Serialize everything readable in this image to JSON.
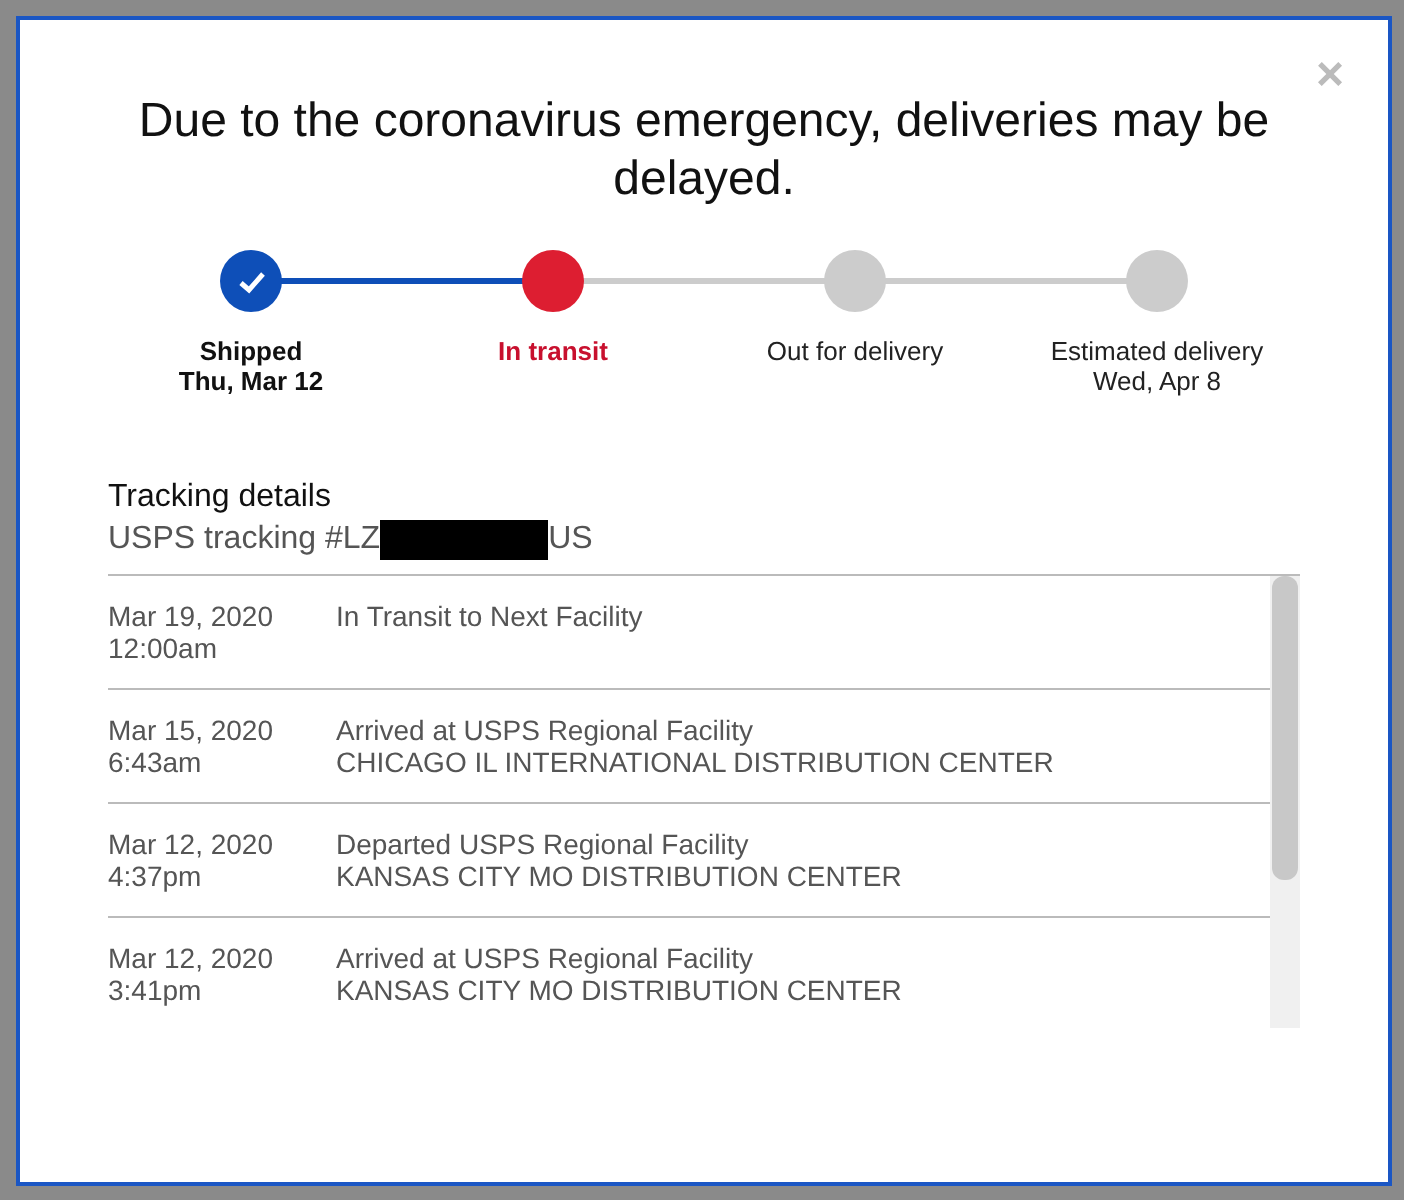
{
  "dialog": {
    "title": "Due to the coronavirus emergency, deliveries may be delayed.",
    "close": "×"
  },
  "steps": [
    {
      "label": "Shipped",
      "date": "Thu, Mar 12",
      "completed": true,
      "selected": false
    },
    {
      "label": "In transit",
      "completed": false,
      "selected": true
    },
    {
      "label": "Out for delivery",
      "completed": false,
      "selected": false
    },
    {
      "label": "Estimated delivery",
      "date": "Wed, Apr 8",
      "completed": false,
      "selected": false
    }
  ],
  "tracking": {
    "heading": "Tracking details",
    "number_prefix": "USPS tracking #LZ",
    "number_suffix": "US",
    "events": [
      {
        "date": "Mar 19, 2020",
        "time": "12:00am",
        "status": "In Transit to Next Facility"
      },
      {
        "date": "Mar 15, 2020",
        "time": "6:43am",
        "status": "Arrived at USPS Regional Facility",
        "location": "CHICAGO IL INTERNATIONAL DISTRIBUTION CENTER"
      },
      {
        "date": "Mar 12, 2020",
        "time": "4:37pm",
        "status": "Departed USPS Regional Facility",
        "location": "KANSAS CITY MO DISTRIBUTION CENTER"
      },
      {
        "date": "Mar 12, 2020",
        "time": "3:41pm",
        "status": "Arrived at USPS Regional Facility",
        "location": "KANSAS CITY MO DISTRIBUTION CENTER"
      }
    ]
  }
}
